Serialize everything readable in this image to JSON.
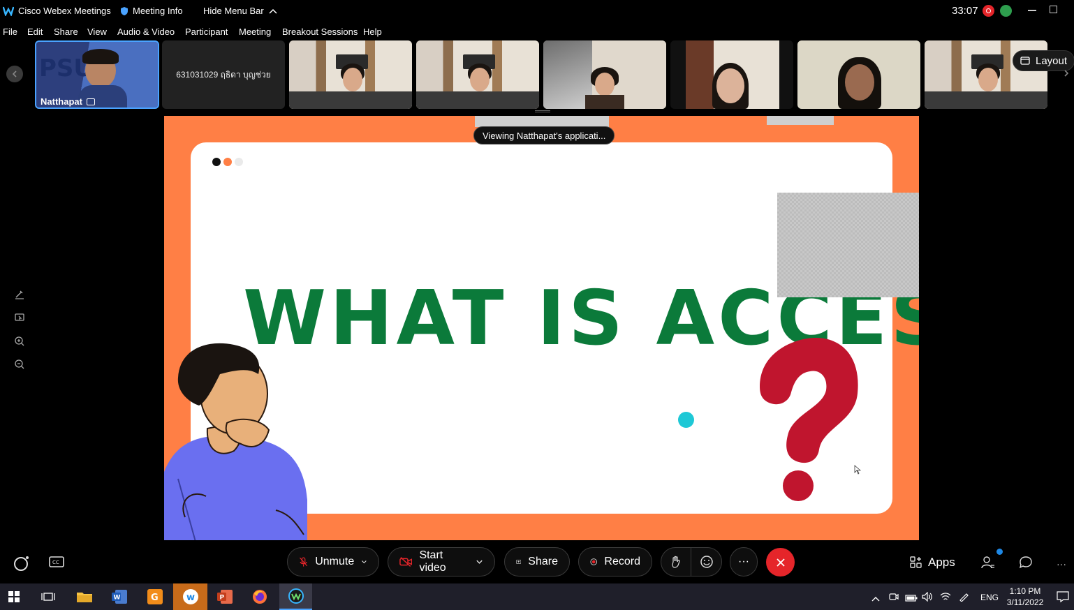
{
  "titlebar": {
    "app_name": "Cisco Webex Meetings",
    "meeting_info": "Meeting Info",
    "hide_menu": "Hide Menu Bar",
    "timer": "33:07"
  },
  "menu": [
    "File",
    "Edit",
    "Share",
    "View",
    "Audio & Video",
    "Participant",
    "Meeting",
    "Breakout Sessions",
    "Help"
  ],
  "participants": {
    "active_name": "Natthapat",
    "name_only_tile": "631031029 ฤธิดา บุญช่วย",
    "layout_label": "Layout"
  },
  "share": {
    "viewing_banner": "Viewing Natthapat's applicati...",
    "headline": "WHAT IS ACCESS"
  },
  "toolbar": {
    "unmute": "Unmute",
    "start_video": "Start video",
    "share": "Share",
    "record": "Record",
    "more": "···",
    "apps": "Apps"
  },
  "taskbar": {
    "lang": "ENG",
    "time": "1:10 PM",
    "date": "3/11/2022"
  },
  "colors": {
    "accent_blue": "#1e88e5",
    "slide_orange": "#ff7f45",
    "headline_green": "#0b7a3a",
    "question_red": "#c0152e",
    "end_red": "#e5252a"
  }
}
